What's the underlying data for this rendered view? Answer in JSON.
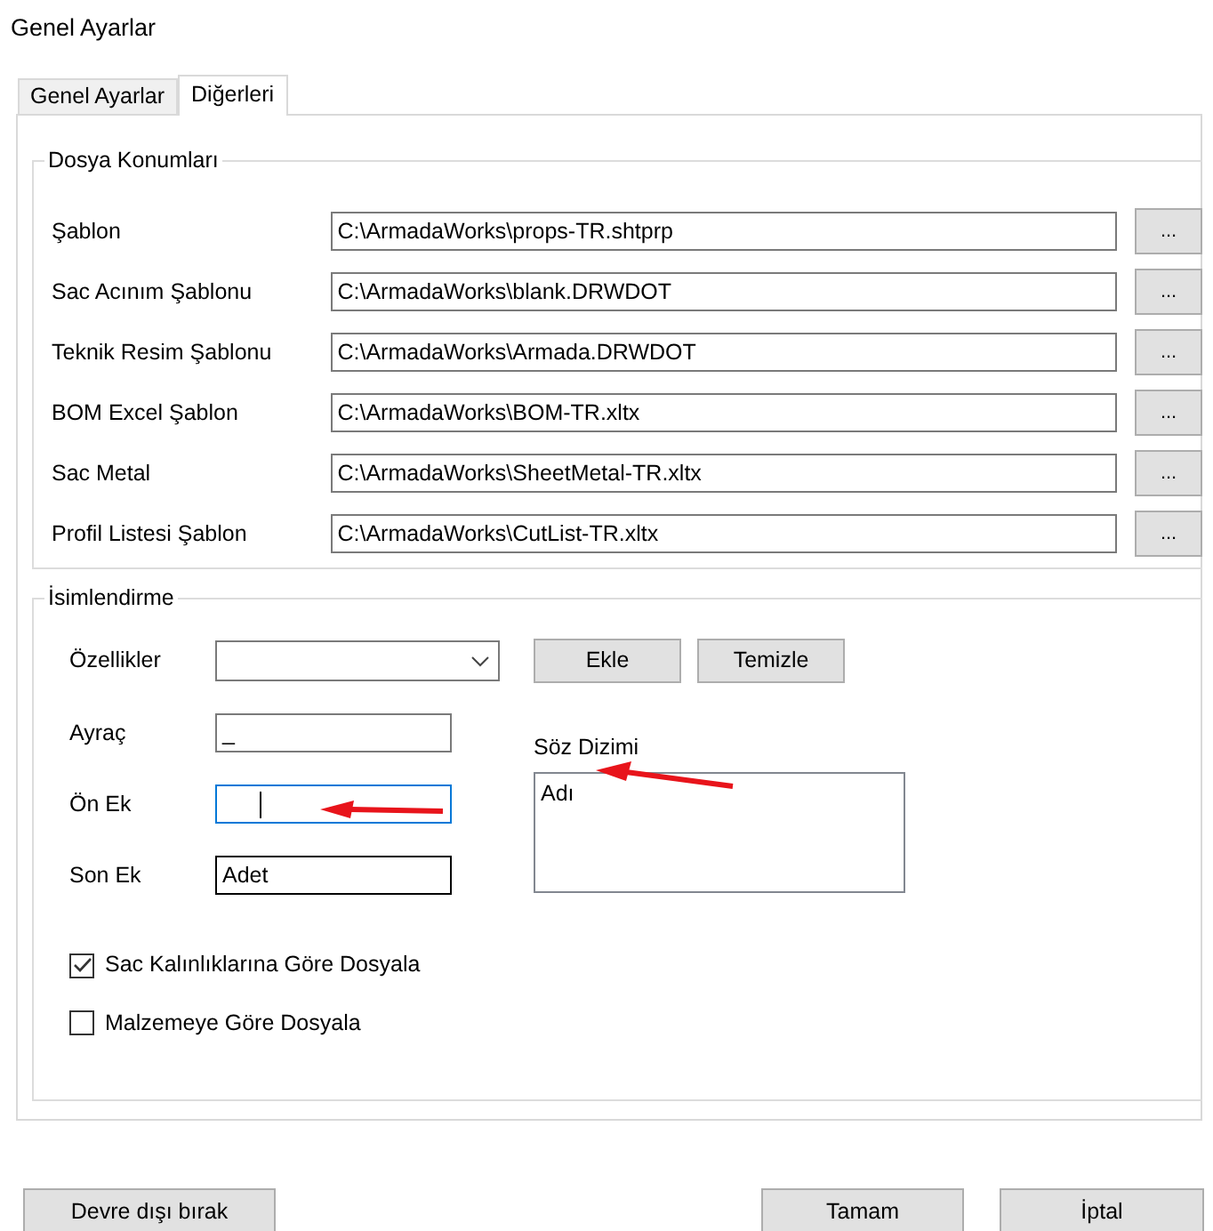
{
  "window": {
    "title": "Genel Ayarlar"
  },
  "tabs": [
    {
      "label": "Genel Ayarlar",
      "selected": false
    },
    {
      "label": "Diğerleri",
      "selected": true
    }
  ],
  "file_locations": {
    "title": "Dosya Konumları",
    "rows": [
      {
        "label": "Şablon",
        "path": "C:\\ArmadaWorks\\props-TR.shtprp",
        "browse": "..."
      },
      {
        "label": "Sac Acınım Şablonu",
        "path": "C:\\ArmadaWorks\\blank.DRWDOT",
        "browse": "..."
      },
      {
        "label": "Teknik Resim Şablonu",
        "path": "C:\\ArmadaWorks\\Armada.DRWDOT",
        "browse": "..."
      },
      {
        "label": "BOM  Excel Şablon",
        "path": "C:\\ArmadaWorks\\BOM-TR.xltx",
        "browse": "..."
      },
      {
        "label": "Sac Metal",
        "path": "C:\\ArmadaWorks\\SheetMetal-TR.xltx",
        "browse": "..."
      },
      {
        "label": "Profil Listesi Şablon",
        "path": "C:\\ArmadaWorks\\CutList-TR.xltx",
        "browse": "..."
      }
    ]
  },
  "naming": {
    "title": "İsimlendirme",
    "properties": {
      "label": "Özellikler"
    },
    "buttons": [
      "Ekle",
      "Temizle"
    ],
    "fields": [
      {
        "label": "Ayraç",
        "value": "_",
        "focused": false
      },
      {
        "label": "Ön Ek",
        "focused": true
      },
      {
        "label": "Son Ek",
        "value": "Adet",
        "focused": false
      }
    ],
    "syntax": {
      "label": "Söz Dizimi",
      "items": [
        "Adı"
      ]
    },
    "checkboxes": [
      {
        "label": "Sac Kalınlıklarına Göre Dosyala",
        "checked": true
      },
      {
        "label": "Malzemeye Göre Dosyala",
        "checked": false
      }
    ]
  },
  "footer_buttons": [
    "Devre dışı bırak",
    "Tamam",
    "İptal"
  ]
}
